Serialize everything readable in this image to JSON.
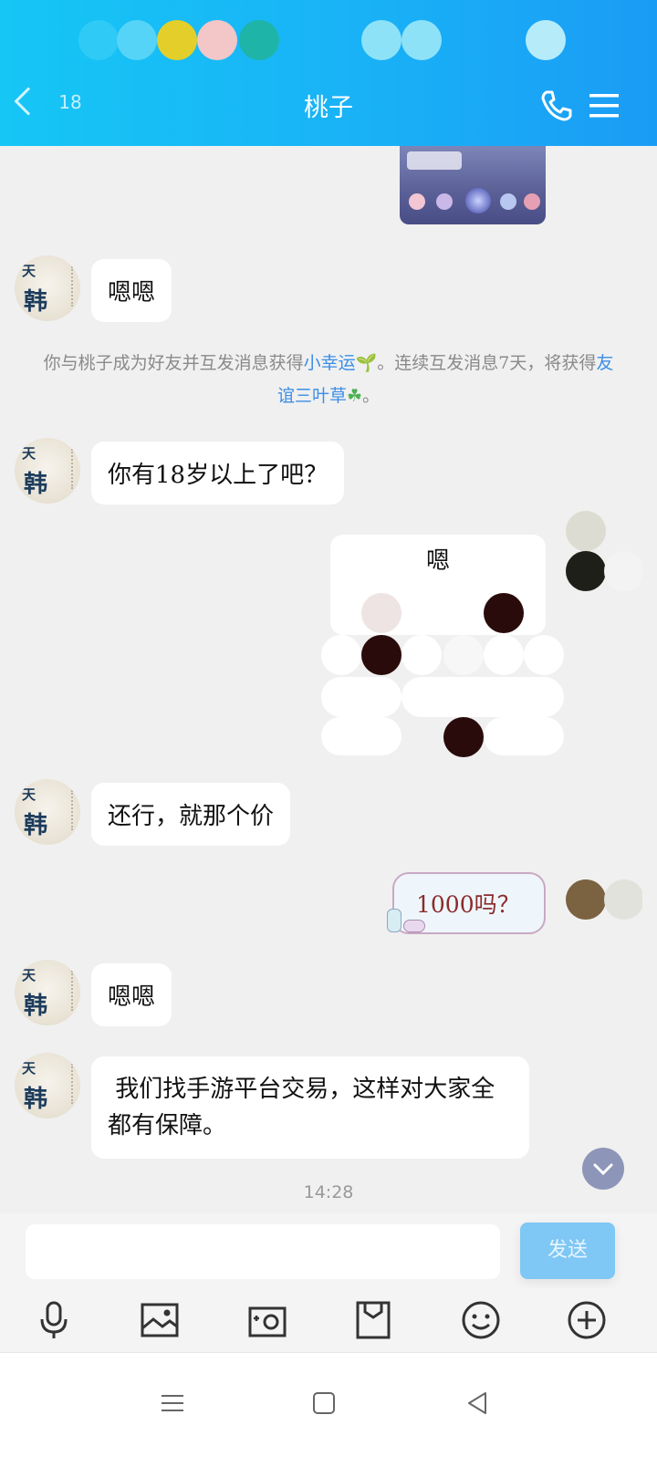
{
  "header": {
    "title": "桃子",
    "unread_badge": "18",
    "phone_icon": "phone-icon",
    "menu_icon": "menu-icon"
  },
  "messages": [
    {
      "side": "left",
      "text": "嗯嗯"
    },
    {
      "side": "left",
      "text": "你有18岁以上了吧？"
    },
    {
      "side": "right",
      "text": "嗯"
    },
    {
      "side": "left",
      "text": "还行，就那个价"
    },
    {
      "side": "right",
      "text": "1000吗？"
    },
    {
      "side": "left",
      "text": "嗯嗯"
    },
    {
      "side": "left",
      "text": " 我们找手游平台交易，这样对大家全都有保障。"
    }
  ],
  "avatar_text": {
    "top": "天",
    "main": "韩"
  },
  "system_notice": {
    "prefix": "你与桃子成为好友并互发消息获得",
    "link1": "小幸运",
    "middle": "。连续互发消息7天，将获得",
    "link2": "友谊三叶草",
    "suffix": "。"
  },
  "timestamp": "14:28",
  "input": {
    "placeholder": "",
    "send_label": "发送"
  },
  "toolbar_icons": [
    "microphone-icon",
    "image-icon",
    "camera-icon",
    "file-icon",
    "emoji-icon",
    "plus-icon"
  ],
  "colors": {
    "accent": "#19b2f6",
    "link": "#3b8ee6",
    "send": "#7fc7f5"
  }
}
